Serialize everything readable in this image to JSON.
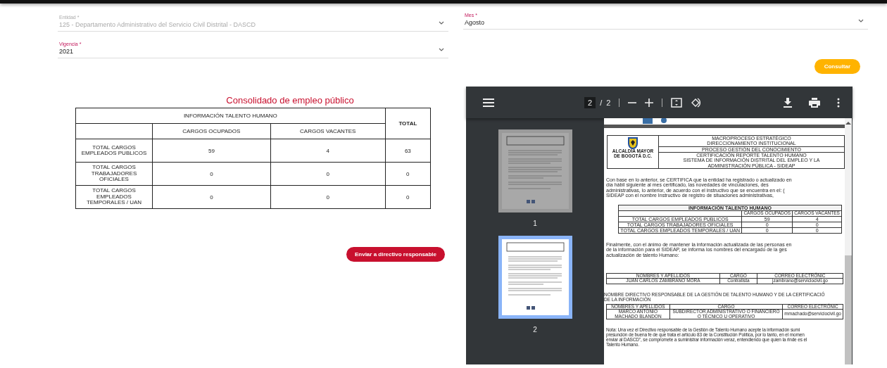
{
  "filters": [
    {
      "label": "Entidad *",
      "value": "125 - Departamento Administrativo del Servicio Civil Distrital - DASCD",
      "disabled": true
    },
    {
      "label": "Vigencia *",
      "value": "2021",
      "disabled": false
    },
    {
      "label": "Mes *",
      "value": "Agosto",
      "disabled": false
    }
  ],
  "consult_button": "Consultar",
  "summary": {
    "title": "Consolidado de empleo público",
    "group_header": "INFORMACIÓN TALENTO HUMANO",
    "total_header": "TOTAL",
    "columns": [
      "CARGOS OCUPADOS",
      "CARGOS VACANTES"
    ],
    "rows": [
      {
        "label": "TOTAL CARGOS EMPLEADOS PUBLICOS",
        "values": [
          "59",
          "4",
          "63"
        ]
      },
      {
        "label": "TOTAL CARGOS TRABAJADORES OFICIALES",
        "values": [
          "0",
          "0",
          "0"
        ]
      },
      {
        "label": "TOTAL CARGOS EMPLEADOS TEMPORALES / UAN",
        "values": [
          "0",
          "0",
          "0"
        ]
      }
    ]
  },
  "send_button": "Enviar a directivo responsable",
  "pdf_viewer": {
    "page": "2",
    "separator": "/",
    "page_count": "2",
    "thumbnails": [
      {
        "label": "1",
        "selected": false
      },
      {
        "label": "2",
        "selected": true
      }
    ],
    "document": {
      "logo_lines": [
        "ALCALDÍA MAYOR",
        "DE BOGOTÁ D.C."
      ],
      "header_lines": [
        [
          "MACROPROCESO ESTRATÉGICO",
          "DIRECCIONAMIENTO INSTITUCIONAL"
        ],
        [
          "PROCESO GESTIÓN DEL CONOCIMIENTO"
        ],
        [
          "CERTIFICACIÓN REPORTE TALENTO HUMANO",
          "SISTEMA DE INFORMACIÓN DISTRITAL DEL EMPLEO Y LA",
          "ADMINISTRACIÓN PÚBLICA - SIDEAP"
        ]
      ],
      "paragraph_1": [
        "Con base en lo anterior, se CERTIFICA que la entidad ha registrado o actualizado en",
        "día hábil siguiente al mes certificado, las novedades de vinculaciones, des",
        "administrativas, lo anterior, de acuerdo con el instructivo que se encuentra en el: (",
        "SIDEAP con el nombre Instructivo de registro de situaciones administrativas,"
      ],
      "talent_table": {
        "title": "INFORMACIÓN TALENTO HUMANO",
        "columns": [
          "CARGOS OCUPADOS",
          "CARGOS VACANTES"
        ],
        "rows": [
          {
            "label": "TOTAL CARGOS EMPLEADOS PÚBLICOS",
            "values": [
              "59",
              "4"
            ]
          },
          {
            "label": "TOTAL CARGOS TRABAJADORES OFICIALES",
            "values": [
              "0",
              "0"
            ]
          },
          {
            "label": "TOTAL CARGOS EMPLEADOS TEMPORALES / UAN",
            "values": [
              "0",
              "0"
            ]
          }
        ]
      },
      "paragraph_2": [
        "Finalmente, con el ánimo de mantener la información actualizada de las personas en",
        "de la información para el SIDEAP, se informa los nombres del encargado de la ges",
        "actualización de talento Humano:"
      ],
      "contact_tables": [
        {
          "columns": [
            "NOMBRES Y APELLIDOS",
            "CARGO",
            "CORREO ELECTRÓNIC"
          ],
          "row": [
            "JUAN CARLOS ZAMBRANO MORA",
            "Contratista",
            "jzambrano@serviciocivil.go"
          ]
        },
        {
          "heading": [
            "NOMBRE DIRECTIVO RESPONSABLE DE LA GESTIÓN DE TALENTO HUMANO Y DE LA CERTIFICACIÓ",
            "DE LA INFORMACIÓN"
          ],
          "columns": [
            "NOMBRES Y APELLIDOS",
            "CARGO",
            "CORREO ELECTRÓNIC"
          ],
          "row": [
            "MARCO ANTONIO MACHADO BLANDON",
            "SUBDIRECTOR ADMINISTRATIVO O FINANCIERO O TÉCNICO U OPERATIVO",
            "mmachado@serviciocivil.go"
          ]
        }
      ],
      "note": [
        "Nota: Una vez el Directivo responsable de la Gestión de Talento Humano acepte la información sumi",
        "presunción de buena fe de que trata el artículo 83 de la Constitución Política, por lo tanto, en el momen",
        "enviar al DASCD\", se compromete a suministrar información veraz, entendiendo que quien la rinde es el",
        "Talento Humano."
      ]
    }
  }
}
